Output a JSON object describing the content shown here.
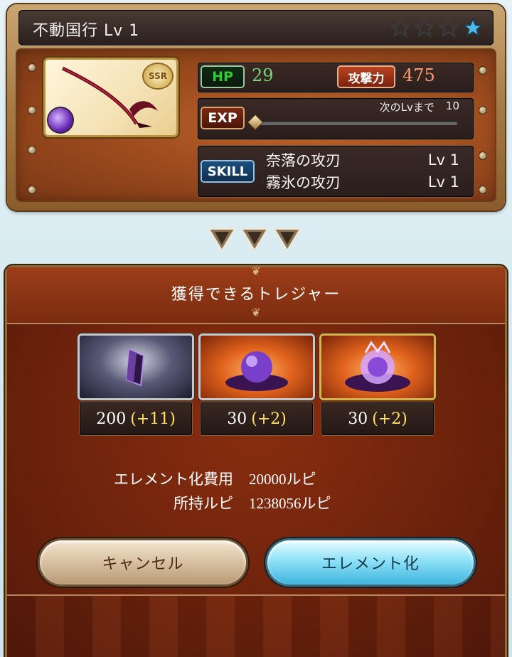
{
  "weapon": {
    "title": "不動国行 Lv 1",
    "rarity": "SSR",
    "stars_filled": 1,
    "stars_total": 4,
    "hp_label": "HP",
    "hp_value": "29",
    "attack_label": "攻撃力",
    "attack_value": "475",
    "exp_label": "EXP",
    "exp_next_label": "次のLvまで",
    "exp_next_value": "10",
    "exp_progress": 0,
    "skill_label": "SKILL",
    "skills": [
      {
        "name": "奈落の攻刃",
        "level": "Lv 1"
      },
      {
        "name": "霧氷の攻刃",
        "level": "Lv 1"
      }
    ]
  },
  "panel": {
    "title": "獲得できるトレジャー",
    "treasures": [
      {
        "icon": "dark-crystal-icon",
        "count": "200",
        "bonus": "(+11)"
      },
      {
        "icon": "dark-orb-icon",
        "count": "30",
        "bonus": "(+2)"
      },
      {
        "icon": "dark-whorl-icon",
        "count": "30",
        "bonus": "(+2)"
      }
    ],
    "cost_label": "エレメント化費用",
    "cost_value": "20000ルピ",
    "owned_label": "所持ルピ",
    "owned_value": "1238056ルピ",
    "cancel_label": "キャンセル",
    "confirm_label": "エレメント化"
  },
  "colors": {
    "hp": "#7ad57a",
    "attack": "#ff9a70",
    "bonus": "#ffe16a",
    "star_active": "#4fb8e6"
  }
}
